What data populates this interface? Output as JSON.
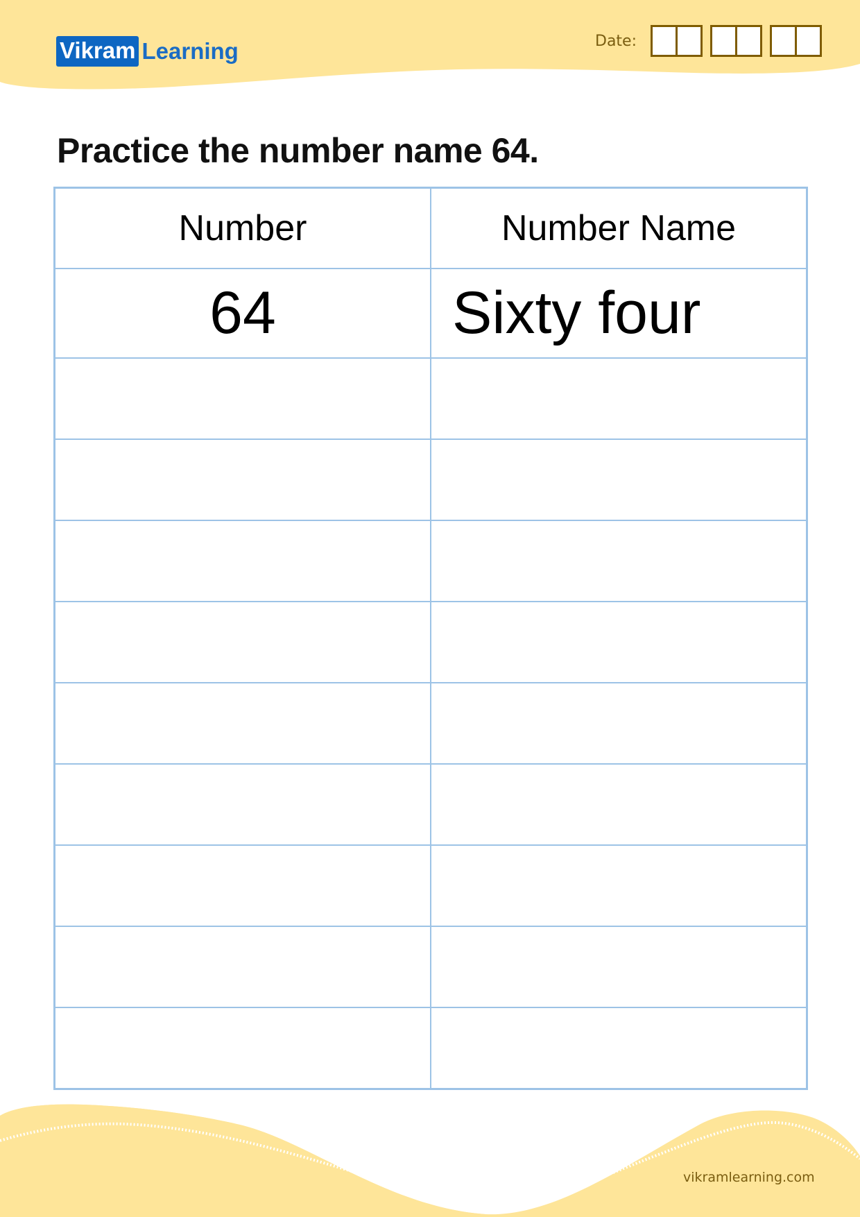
{
  "brand": {
    "logo_box_text": "Vikram",
    "logo_text": "Learning",
    "colors": {
      "box": "#0d66c2",
      "text": "#1a6cc4",
      "band": "#fee599",
      "border": "#9dc3e6",
      "date_box": "#7f5c00"
    }
  },
  "date": {
    "label": "Date:",
    "groups": [
      {
        "cells": 2
      },
      {
        "cells": 2
      },
      {
        "cells": 2
      }
    ]
  },
  "title": "Practice the number name 64.",
  "table": {
    "headers": [
      "Number",
      "Number Name"
    ],
    "example": {
      "number": "64",
      "name": "Sixty four"
    },
    "blank_rows": 9
  },
  "footer": {
    "url": "vikramlearning.com"
  }
}
